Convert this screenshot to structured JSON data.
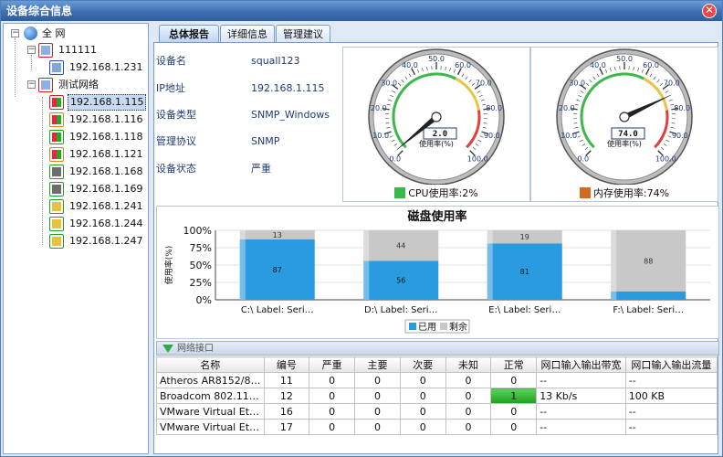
{
  "window": {
    "title": "设备综合信息",
    "close": "✕"
  },
  "tree": {
    "root": "全 网",
    "groups": [
      {
        "label": "111111",
        "children": [
          "192.168.1.231"
        ]
      },
      {
        "label": "测试网络",
        "children": [
          "192.168.1.115",
          "192.168.1.116",
          "192.168.1.118",
          "192.168.1.121",
          "192.168.1.168",
          "192.168.1.169",
          "192.168.1.241",
          "192.168.1.244",
          "192.168.1.247"
        ]
      }
    ],
    "selected": "192.168.1.115"
  },
  "tabs": [
    "总体报告",
    "详细信息",
    "管理建议"
  ],
  "device": {
    "rows": [
      {
        "key": "设备名",
        "value": "squall123"
      },
      {
        "key": "IP地址",
        "value": "192.168.1.115"
      },
      {
        "key": "设备类型",
        "value": "SNMP_Windows"
      },
      {
        "key": "管理协议",
        "value": "SNMP"
      },
      {
        "key": "设备状态",
        "value": "严重"
      }
    ]
  },
  "gauges": [
    {
      "value_text": "2.0",
      "unit_label": "使用率(%)",
      "value": 2,
      "legend": "CPU使用率:2%",
      "legend_color": "#3cb84a",
      "ticks": [
        "0.0",
        "10.0",
        "20.0",
        "30.0",
        "40.0",
        "50.0",
        "60.0",
        "70.0",
        "80.0",
        "90.0",
        "100.0"
      ]
    },
    {
      "value_text": "74.0",
      "unit_label": "使用率(%)",
      "value": 74,
      "legend": "内存使用率:74%",
      "legend_color": "#d2691e",
      "ticks": [
        "0.0",
        "10.0",
        "20.0",
        "30.0",
        "40.0",
        "50.0",
        "60.0",
        "70.0",
        "80.0",
        "90.0",
        "100.0"
      ]
    }
  ],
  "chart_data": {
    "type": "bar",
    "title": "磁盘使用率",
    "ylabel": "使用率(%)",
    "xlabel": "",
    "ylim": [
      0,
      100
    ],
    "yticks": [
      "0%",
      "25%",
      "50%",
      "75%",
      "100%"
    ],
    "categories": [
      "C:\\ Label:  Seri…",
      "D:\\ Label:  Seri…",
      "E:\\ Label:  Seri…",
      "F:\\ Label:  Seri…"
    ],
    "series": [
      {
        "name": "已用",
        "color": "#2b9be0",
        "values": [
          87,
          56,
          81,
          12
        ]
      },
      {
        "name": "剩余",
        "color": "#c8c8c8",
        "values": [
          13,
          44,
          19,
          88
        ]
      }
    ],
    "data_labels": {
      "used": [
        "87",
        "56",
        "81",
        ""
      ],
      "free": [
        "13",
        "44",
        "19",
        "88"
      ]
    },
    "legend_position": "bottom"
  },
  "network": {
    "title": "网络接口",
    "columns": [
      "名称",
      "编号",
      "严重",
      "主要",
      "次要",
      "未知",
      "正常",
      "网口输入输出带宽",
      "网口输入输出流量"
    ],
    "rows": [
      [
        "Atheros AR8152/8…",
        "11",
        "0",
        "0",
        "0",
        "0",
        "0",
        "--",
        "--"
      ],
      [
        "Broadcom 802.11…",
        "12",
        "0",
        "0",
        "0",
        "0",
        "1",
        "13 Kb/s",
        "100 KB"
      ],
      [
        "VMware Virtual Et…",
        "16",
        "0",
        "0",
        "0",
        "0",
        "0",
        "--",
        "--"
      ],
      [
        "VMware Virtual Et…",
        "17",
        "0",
        "0",
        "0",
        "0",
        "0",
        "--",
        "--"
      ]
    ],
    "highlight": {
      "row": 1,
      "col": 6
    }
  }
}
